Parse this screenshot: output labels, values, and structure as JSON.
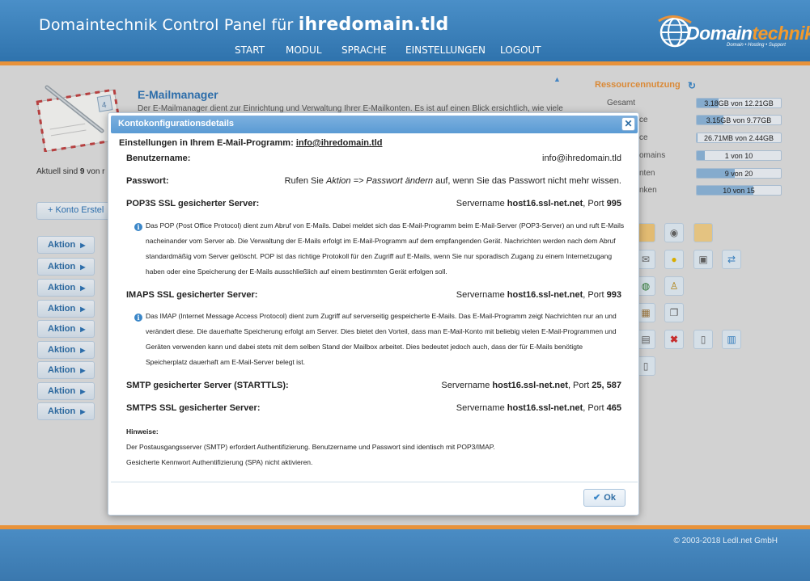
{
  "header": {
    "title_prefix": "Domaintechnik Control Panel für",
    "title_domain": "ihredomain.tld",
    "nav": [
      "START",
      "MODUL",
      "SPRACHE",
      "EINSTELLUNGEN",
      "LOGOUT"
    ],
    "logo_main": "Domain",
    "logo_accent": "technik",
    "logo_tagline": "Domain • Hosting • Support"
  },
  "background": {
    "page_title": "E-Mailmanager",
    "page_desc": "Der E-Mailmanager dient zur Einrichtung und Verwaltung Ihrer E-Mailkonten. Es ist auf einen Blick ersichtlich, wie viele",
    "aktuell_prefix": "Aktuell sind",
    "aktuell_count": "9",
    "aktuell_suffix": "von r",
    "konto_button": "Konto Erstel",
    "aktion_label": "Aktion",
    "resources": {
      "title": "Ressourcennutzung",
      "rows": [
        {
          "label": "Gesamt",
          "value": "3.18GB von 12.21GB",
          "fill": 0.26
        },
        {
          "label": "ce",
          "value": "3.15GB von 9.77GB",
          "fill": 0.32
        },
        {
          "label": "ce",
          "value": "26.71MB von 2.44GB",
          "fill": 0.01
        },
        {
          "label": "omains",
          "value": "1 von 10",
          "fill": 0.1
        },
        {
          "label": "nten",
          "value": "9 von 20",
          "fill": 0.45
        },
        {
          "label": "nken",
          "value": "10 von 15",
          "fill": 0.67
        }
      ]
    }
  },
  "modal": {
    "title": "Kontokonfigurationsdetails",
    "subtitle_prefix": "Einstellungen in Ihrem E-Mail-Programm:",
    "subtitle_email": "info@ihredomain.tld",
    "username_label": "Benutzername:",
    "username_value": "info@ihredomain.tld",
    "password_label": "Passwort:",
    "password_pre": "Rufen Sie ",
    "password_em": "Aktion => Passwort ändern",
    "password_post": " auf, wenn Sie das Passwort nicht mehr wissen.",
    "pop3": {
      "label": "POP3S SSL gesicherter Server:",
      "server_prefix": "Servername",
      "host": "host16.ssl-net.net",
      "port_prefix": ", Port",
      "port": "995",
      "info": "Das POP (Post Office Protocol) dient zum Abruf von E-Mails. Dabei meldet sich das E-Mail-Programm beim E-Mail-Server (POP3-Server) an und ruft E-Mails nacheinander vom Server ab. Die Verwaltung der E-Mails erfolgt im E-Mail-Programm auf dem empfangenden Gerät. Nachrichten werden nach dem Abruf standardmäßig vom Server gelöscht. POP ist das richtige Protokoll für den Zugriff auf E-Mails, wenn Sie nur sporadisch Zugang zu einem Internetzugang haben oder eine Speicherung der E-Mails ausschließlich auf einem bestimmten Gerät erfolgen soll."
    },
    "imap": {
      "label": "IMAPS SSL gesicherter Server:",
      "server_prefix": "Servername",
      "host": "host16.ssl-net.net",
      "port_prefix": ", Port",
      "port": "993",
      "info": "Das IMAP (Internet Message Access Protocol) dient zum Zugriff auf serverseitig gespeicherte E-Mails. Das E-Mail-Programm zeigt Nachrichten nur an und verändert diese. Die dauerhafte Speicherung erfolgt am Server. Dies bietet den Vorteil, dass man E-Mail-Konto mit beliebig vielen E-Mail-Programmen und Geräten verwenden kann und dabei stets mit dem selben Stand der Mailbox arbeitet. Dies bedeutet jedoch auch, dass der für E-Mails benötigte Speicherplatz dauerhaft am E-Mail-Server belegt ist."
    },
    "smtp": {
      "label": "SMTP gesicherter Server (STARTTLS):",
      "server_prefix": "Servername",
      "host": "host16.ssl-net.net",
      "port_prefix": ", Port",
      "port": "25, 587"
    },
    "smtps": {
      "label": "SMTPS SSL gesicherter Server:",
      "server_prefix": "Servername",
      "host": "host16.ssl-net.net",
      "port_prefix": ", Port",
      "port": "465"
    },
    "hints_title": "Hinweise:",
    "hints": [
      "Der Postausgangsserver (SMTP) erfordert Authentifizierung. Benutzername und Passwort sind identisch mit POP3/IMAP.",
      "Gesicherte Kennwort Authentifizierung (SPA) nicht aktivieren."
    ],
    "ok_label": "Ok"
  },
  "footer": {
    "copyright": "© 2003-2018 LedI.net GmbH"
  },
  "colors": {
    "header_blue": "#3b82c0",
    "accent_orange": "#e8923a",
    "link_blue": "#2f74b5"
  }
}
